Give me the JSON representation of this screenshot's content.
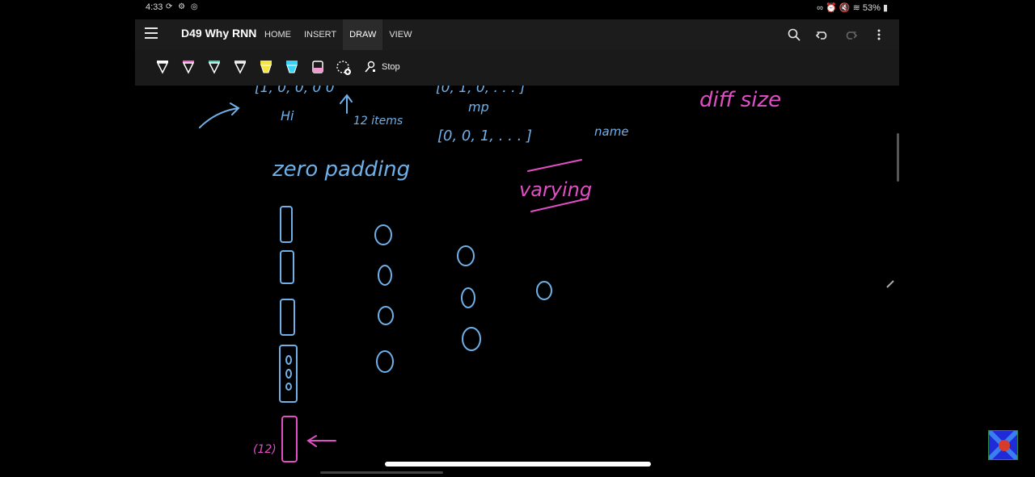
{
  "status_bar": {
    "time": "4:33",
    "left_icons": [
      "sync-icon",
      "settings-icon",
      "instagram-icon"
    ],
    "battery": "53%"
  },
  "app": {
    "title": "D49 Why RNN",
    "tabs": [
      {
        "label": "HOME",
        "active": false
      },
      {
        "label": "INSERT",
        "active": false
      },
      {
        "label": "DRAW",
        "active": true
      },
      {
        "label": "VIEW",
        "active": false
      }
    ],
    "actions": [
      "search-icon",
      "undo-icon",
      "redo-icon",
      "more-icon"
    ]
  },
  "toolbar": {
    "pens": [
      {
        "name": "pen-white",
        "color": "#ffffff"
      },
      {
        "name": "pen-pink",
        "color": "#ff66cc"
      },
      {
        "name": "pen-teal",
        "color": "#49d6b3"
      },
      {
        "name": "pen-light",
        "color": "#dddddd"
      },
      {
        "name": "highlighter-yellow",
        "color": "#f5e642"
      },
      {
        "name": "highlighter-cyan",
        "color": "#38d3f5"
      },
      {
        "name": "highlighter-pink",
        "color": "#f19ad0"
      },
      {
        "name": "lasso-add",
        "color": "#ffffff"
      }
    ],
    "stop_label": "Stop"
  },
  "ink": {
    "blue": "#6fb0e8",
    "pink": "#e04fc4",
    "text": {
      "top_row_left": "[1, 0, 0, 0 0",
      "top_row_right": "[0, 1, 0, . . . ]",
      "hi": "Hi",
      "items_12": "12 items",
      "mp": "mp",
      "vector": "[0, 0, 1, . . . ]",
      "name": "name",
      "diff_size": "diff size",
      "zero_padding": "zero padding",
      "varying": "varying",
      "vector_12": "(12)"
    }
  }
}
